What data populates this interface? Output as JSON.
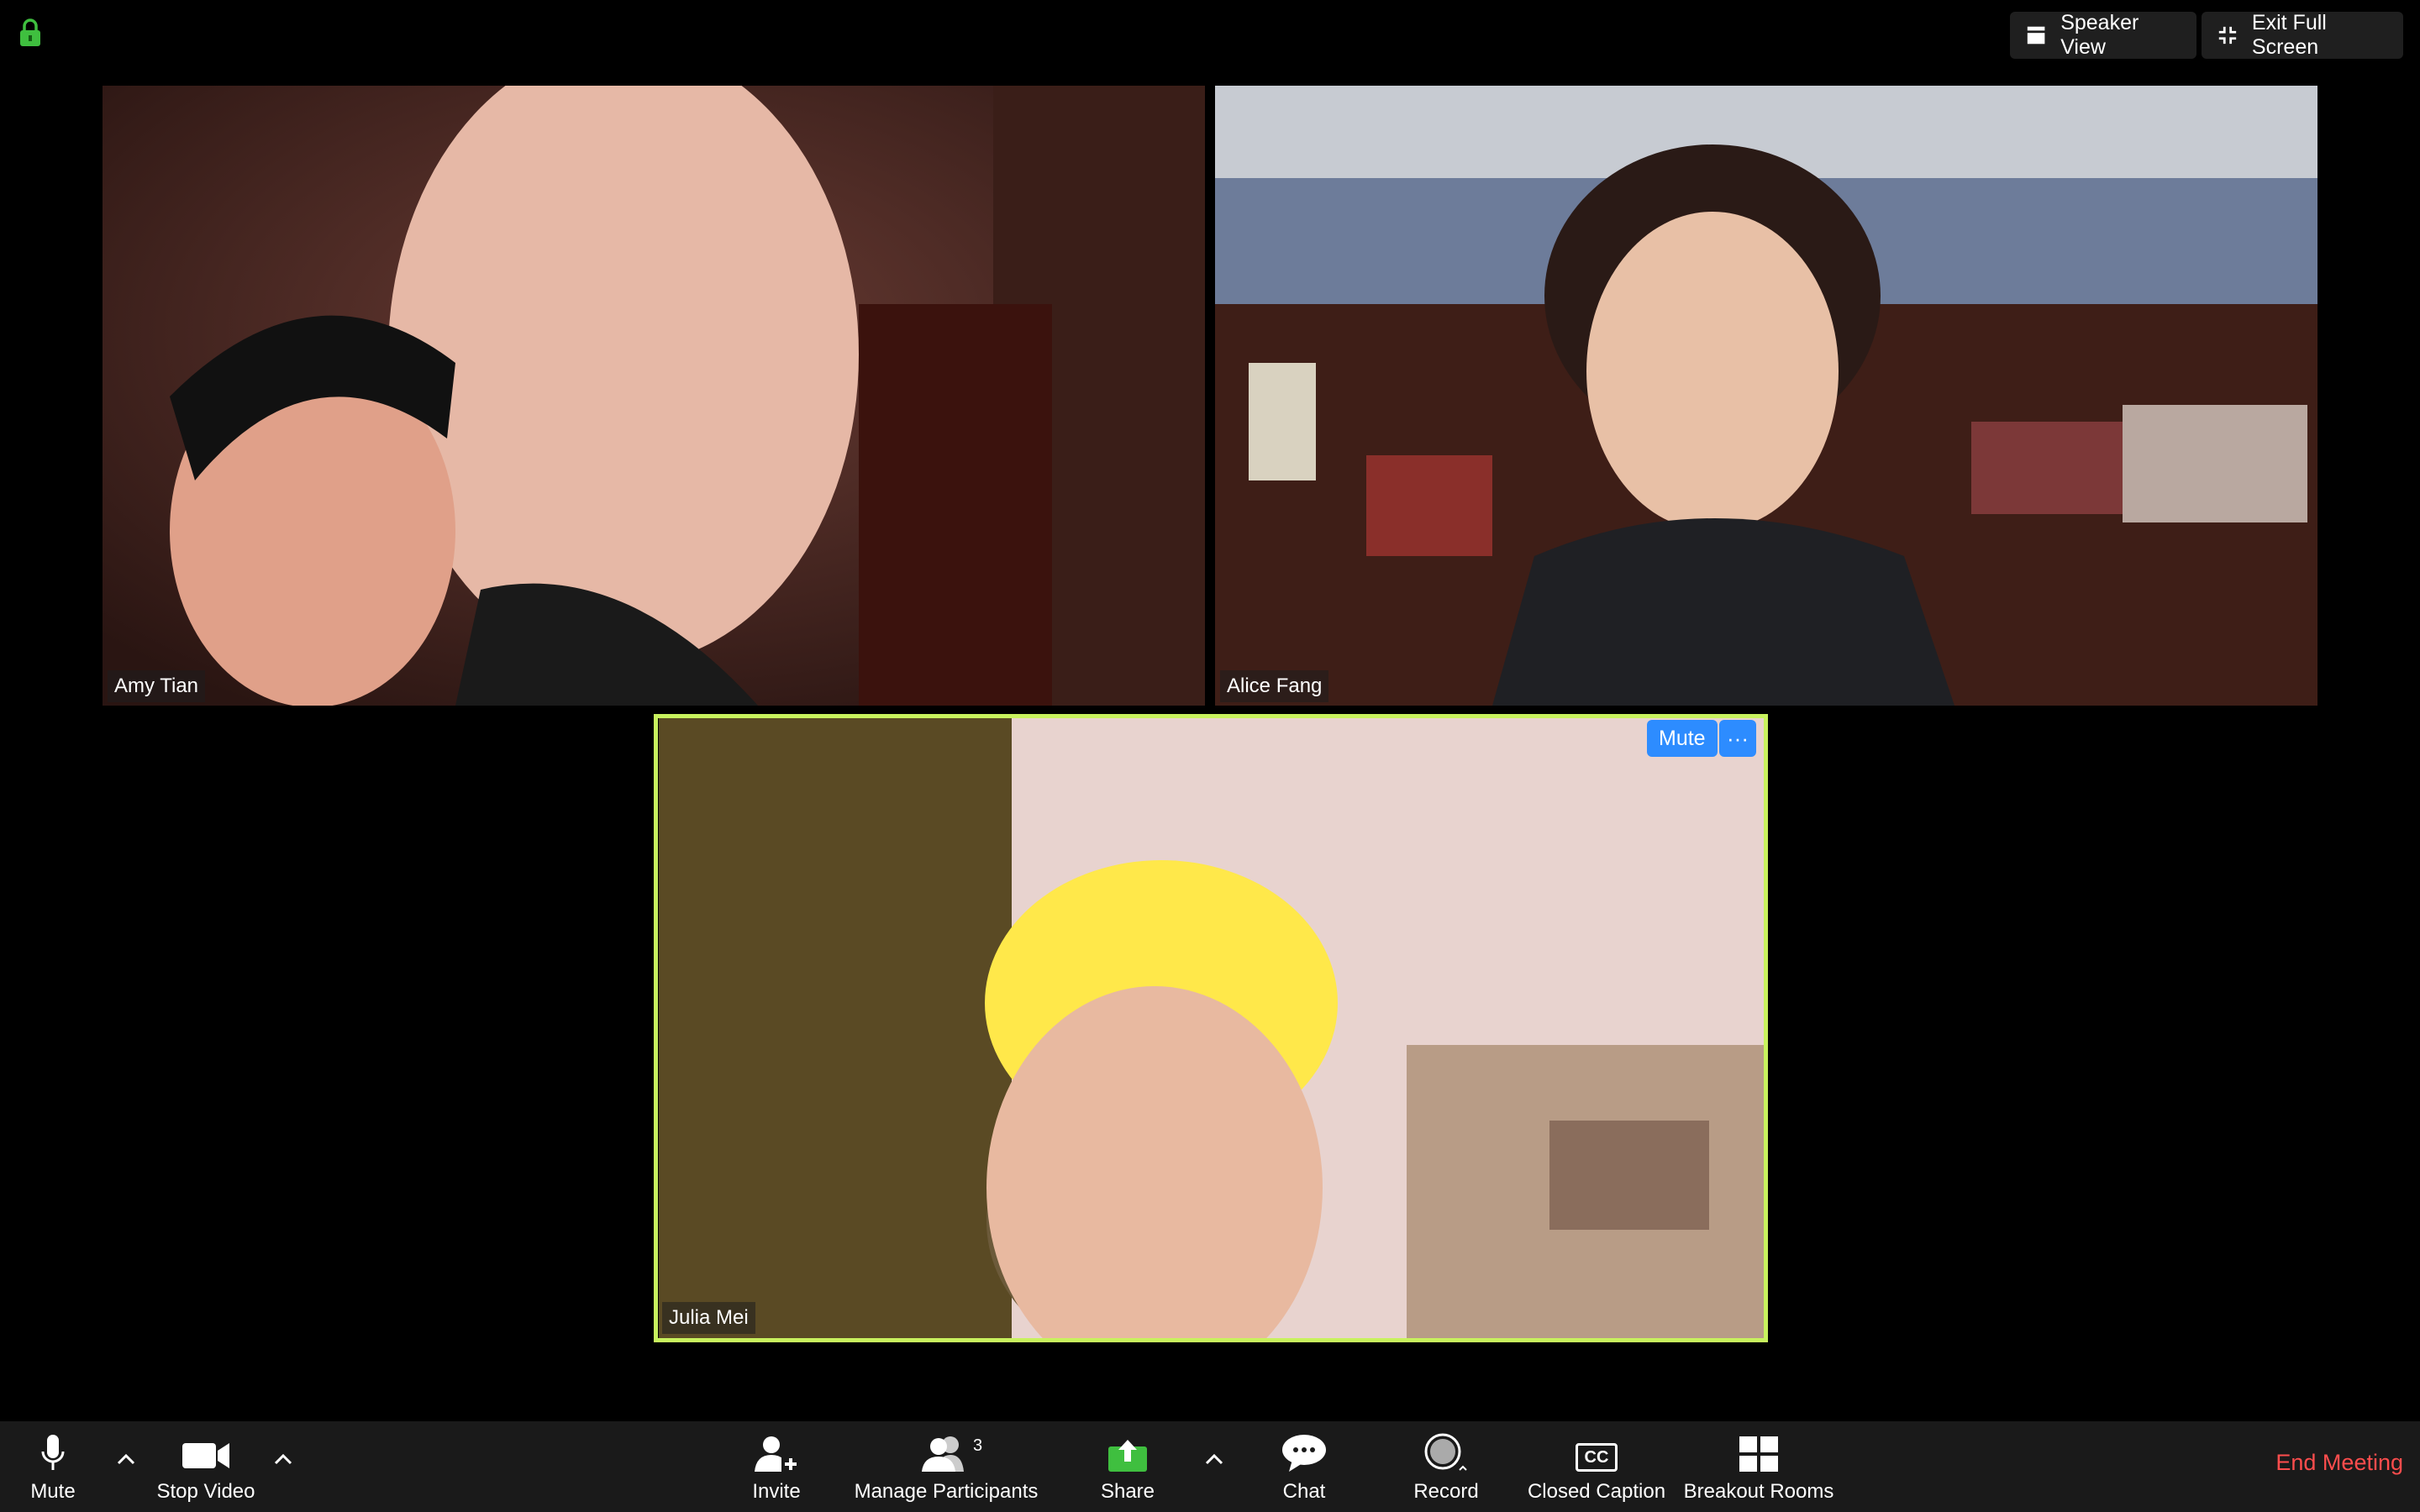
{
  "top_bar": {
    "speaker_view_label": "Speaker View",
    "exit_full_screen_label": "Exit Full Screen"
  },
  "participants": [
    {
      "name": "Amy Tian"
    },
    {
      "name": "Alice Fang"
    },
    {
      "name": "Julia Mei",
      "active_speaker": true
    }
  ],
  "active_tile": {
    "mute_label": "Mute",
    "more_label": "···"
  },
  "toolbar": {
    "mute_label": "Mute",
    "stop_video_label": "Stop Video",
    "invite_label": "Invite",
    "manage_participants_label": "Manage Participants",
    "participant_count": "3",
    "share_label": "Share",
    "chat_label": "Chat",
    "record_label": "Record",
    "closed_caption_label": "Closed Caption",
    "cc_glyph": "CC",
    "breakout_rooms_label": "Breakout Rooms",
    "end_meeting_label": "End Meeting"
  },
  "colors": {
    "active_border": "#c8f25e",
    "accent_blue": "#2d8cff",
    "share_green": "#3fbf3f",
    "end_meeting": "#ff4d4d",
    "lock_green": "#3fbf3f"
  }
}
